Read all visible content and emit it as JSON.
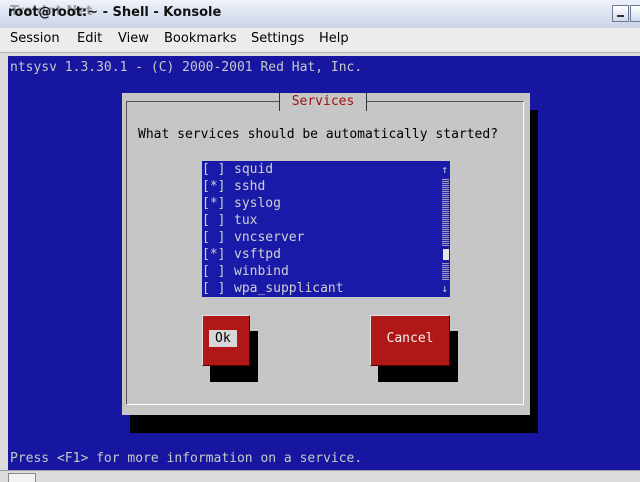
{
  "window": {
    "title": "root@root:~ - Shell - Konsole",
    "title_overlay": "Traidnt Net"
  },
  "menubar": [
    "Session",
    "Edit",
    "View",
    "Bookmarks",
    "Settings",
    "Help"
  ],
  "terminal": {
    "header": "ntsysv 1.3.30.1 - (C) 2000-2001 Red Hat, Inc.",
    "footer": "Press <F1> for more information on a service."
  },
  "dialog": {
    "title": "Services",
    "question": "What services should be automatically started?",
    "services": [
      {
        "mark": "[ ]",
        "name": "squid",
        "checked": false
      },
      {
        "mark": "[*]",
        "name": "sshd",
        "checked": true
      },
      {
        "mark": "[*]",
        "name": "syslog",
        "checked": true
      },
      {
        "mark": "[ ]",
        "name": "tux",
        "checked": false
      },
      {
        "mark": "[ ]",
        "name": "vncserver",
        "checked": false
      },
      {
        "mark": "[*]",
        "name": "vsftpd",
        "checked": true
      },
      {
        "mark": "[ ]",
        "name": "winbind",
        "checked": false
      },
      {
        "mark": "[ ]",
        "name": "wpa_supplicant",
        "checked": false
      }
    ],
    "scroll_up": "↑",
    "scroll_down": "↓",
    "ok_label": "Ok",
    "cancel_label": "Cancel"
  },
  "colors": {
    "terminal_bg": "#1616a0",
    "dialog_bg": "#c6c6c6",
    "button_red": "#b01818",
    "title_red": "#a01010"
  }
}
